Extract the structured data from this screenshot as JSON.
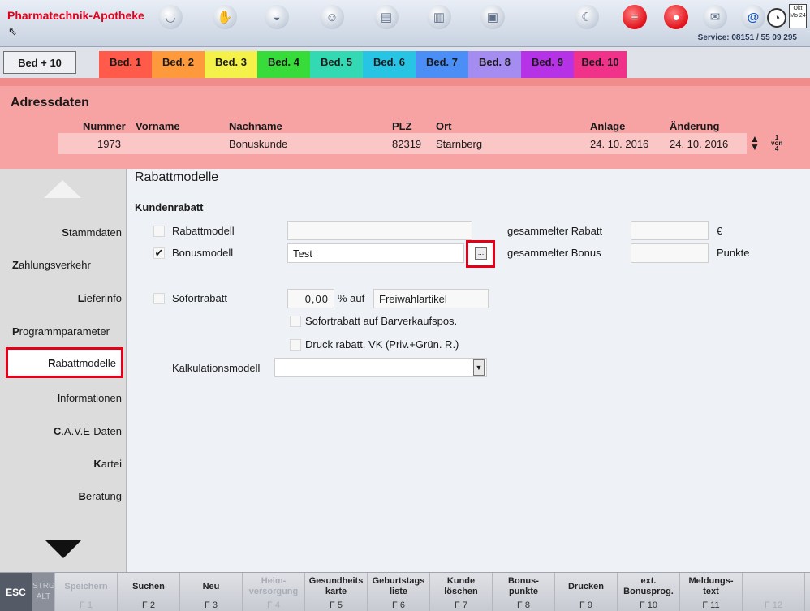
{
  "app": {
    "title": "Pharmatechnik-Apotheke",
    "service": "Service: 08151 / 55 09 295",
    "calendar_month": "Okt",
    "calendar_day": "Mo 24",
    "toolbar_icons": [
      "mortar-icon",
      "handshake-icon",
      "bag-icon",
      "faces-icon",
      "printer-icon",
      "book-icon",
      "scanner-icon",
      "moon-icon",
      "chat-bubble-icon",
      "drop-icon",
      "mail-icon",
      "at-sign-icon",
      "clock-icon"
    ]
  },
  "tabs": {
    "bed_plus": "Bed + 10",
    "items": [
      {
        "label": "Bed. 1",
        "color": "#ff5a4a"
      },
      {
        "label": "Bed. 2",
        "color": "#ff9a3c"
      },
      {
        "label": "Bed. 3",
        "color": "#f4f24a"
      },
      {
        "label": "Bed. 4",
        "color": "#37db3a"
      },
      {
        "label": "Bed. 5",
        "color": "#33d9b2"
      },
      {
        "label": "Bed. 6",
        "color": "#28c4e4"
      },
      {
        "label": "Bed. 7",
        "color": "#4a8ef6"
      },
      {
        "label": "Bed. 8",
        "color": "#a48cf0"
      },
      {
        "label": "Bed. 9",
        "color": "#b632e6"
      },
      {
        "label": "Bed. 10",
        "color": "#f0328a"
      }
    ]
  },
  "address": {
    "title": "Adressdaten",
    "headers": {
      "nummer": "Nummer",
      "vorname": "Vorname",
      "nachname": "Nachname",
      "plz": "PLZ",
      "ort": "Ort",
      "anlage": "Anlage",
      "aenderung": "Änderung"
    },
    "row": {
      "nummer": "1973",
      "vorname": "",
      "nachname": "Bonuskunde",
      "plz": "82319",
      "ort": "Starnberg",
      "anlage": "24. 10. 2016",
      "aenderung": "24. 10. 2016"
    },
    "page": {
      "current": "1",
      "of": "von",
      "total": "4"
    }
  },
  "nav": {
    "items": [
      {
        "first": "S",
        "rest": "tammdaten"
      },
      {
        "first": "Z",
        "rest": "ahlungsverkehr"
      },
      {
        "first": "L",
        "rest": "ieferinfo"
      },
      {
        "first": "P",
        "rest": "rogrammparameter"
      },
      {
        "first": "R",
        "rest": "abattmodelle"
      },
      {
        "first": "I",
        "rest": "nformationen"
      },
      {
        "first": "C",
        "rest": ".A.V.E-Daten"
      },
      {
        "first": "K",
        "rest": "artei"
      },
      {
        "first": "B",
        "rest": "eratung"
      }
    ]
  },
  "main": {
    "title": "Rabattmodelle",
    "section": "Kundenrabatt",
    "rabattmodell": {
      "label": "Rabattmodell",
      "checked": false,
      "value": ""
    },
    "bonusmodell": {
      "label": "Bonusmodell",
      "checked": true,
      "check_glyph": "✔",
      "value": "Test"
    },
    "browse_label": "...",
    "gesammelter_rabatt": {
      "label": "gesammelter Rabatt",
      "value": "",
      "unit": "€"
    },
    "gesammelter_bonus": {
      "label": "gesammelter Bonus",
      "value": "",
      "unit": "Punkte"
    },
    "sofortrabatt": {
      "label": "Sofortrabatt",
      "value": "0,00",
      "percent_auf": "% auf",
      "target": "Freiwahlartikel"
    },
    "sofortrabatt_bar": "Sofortrabatt auf Barverkaufspos.",
    "druck_rabatt": "Druck rabatt. VK (Priv.+Grün. R.)",
    "kalkulation": {
      "label": "Kalkulationsmodell",
      "value": ""
    }
  },
  "fkeys": {
    "esc": "ESC",
    "strg": "STRG",
    "alt": "ALT",
    "items": [
      {
        "label": "Speichern",
        "fn": "F 1",
        "enabled": false
      },
      {
        "label": "Suchen",
        "fn": "F 2",
        "enabled": true
      },
      {
        "label": "Neu",
        "fn": "F 3",
        "enabled": true
      },
      {
        "label": "Heim-\nversorgung",
        "fn": "F 4",
        "enabled": false
      },
      {
        "label": "Gesundheits\nkarte",
        "fn": "F 5",
        "enabled": true
      },
      {
        "label": "Geburtstags\nliste",
        "fn": "F 6",
        "enabled": true
      },
      {
        "label": "Kunde\nlöschen",
        "fn": "F 7",
        "enabled": true
      },
      {
        "label": "Bonus-\npunkte",
        "fn": "F 8",
        "enabled": true
      },
      {
        "label": "Drucken",
        "fn": "F 9",
        "enabled": true
      },
      {
        "label": "ext.\nBonusprog.",
        "fn": "F 10",
        "enabled": true
      },
      {
        "label": "Meldungs-\ntext",
        "fn": "F 11",
        "enabled": true
      },
      {
        "label": "",
        "fn": "F 12",
        "enabled": false
      }
    ]
  }
}
